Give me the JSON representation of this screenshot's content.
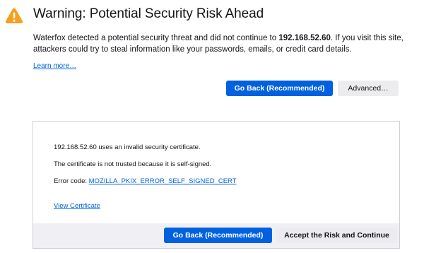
{
  "warning": {
    "title": "Warning: Potential Security Risk Ahead",
    "intro_prefix": "Waterfox detected a potential security threat and did not continue to ",
    "host": "192.168.52.60",
    "intro_suffix": ". If you visit this site, attackers could try to steal information like your passwords, emails, or credit card details.",
    "learn_more": "Learn more…",
    "icon": "warning-triangle-icon",
    "accent_color": "#f7a01d"
  },
  "actions": {
    "go_back_label": "Go Back (Recommended)",
    "advanced_label": "Advanced…"
  },
  "advanced_panel": {
    "line1": "192.168.52.60 uses an invalid security certificate.",
    "line2": "The certificate is not trusted because it is self-signed.",
    "error_code_prefix": "Error code: ",
    "error_code": "MOZILLA_PKIX_ERROR_SELF_SIGNED_CERT",
    "view_certificate": "View Certificate",
    "go_back_label": "Go Back (Recommended)",
    "accept_label": "Accept the Risk and Continue"
  },
  "colors": {
    "primary_button": "#0061e0",
    "link": "#0060df",
    "secondary_button": "#ececee",
    "panel_footer": "#f0f0f4"
  }
}
